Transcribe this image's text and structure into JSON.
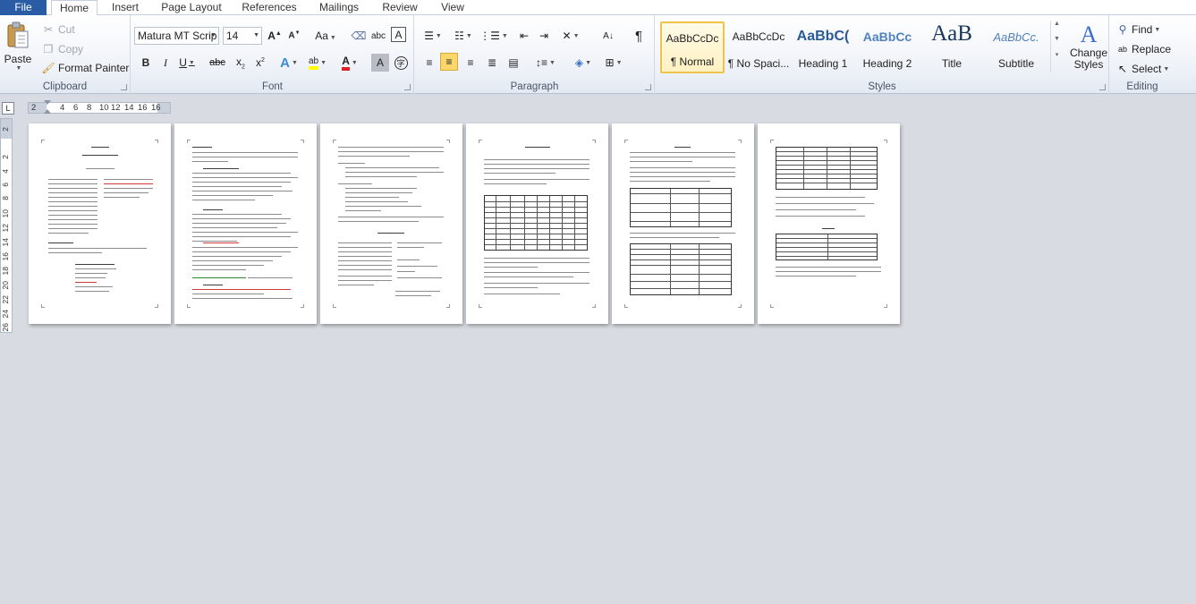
{
  "tabs": {
    "file": "File",
    "home": "Home",
    "insert": "Insert",
    "page_layout": "Page Layout",
    "references": "References",
    "mailings": "Mailings",
    "review": "Review",
    "view": "View"
  },
  "clipboard": {
    "label": "Clipboard",
    "paste": "Paste",
    "cut": "Cut",
    "copy": "Copy",
    "format_painter": "Format Painter"
  },
  "font": {
    "label": "Font",
    "name": "Matura MT Scrip",
    "size": "14"
  },
  "paragraph": {
    "label": "Paragraph"
  },
  "styles": {
    "label": "Styles",
    "items": [
      {
        "preview": "AaBbCcDc",
        "name": "¶ Normal"
      },
      {
        "preview": "AaBbCcDc",
        "name": "¶ No Spaci..."
      },
      {
        "preview": "AaBbC(",
        "name": "Heading 1"
      },
      {
        "preview": "AaBbCc",
        "name": "Heading 2"
      },
      {
        "preview": "AaB",
        "name": "Title"
      },
      {
        "preview": "AaBbCc.",
        "name": "Subtitle"
      }
    ],
    "change_styles": "Change Styles"
  },
  "editing": {
    "label": "Editing",
    "find": "Find",
    "replace": "Replace",
    "select": "Select"
  },
  "ruler": {
    "corner": "L",
    "h_ticks": [
      "2",
      "2",
      "4",
      "6",
      "8",
      "10",
      "12",
      "14",
      "16"
    ],
    "v_ticks": [
      "2",
      "2",
      "4",
      "6",
      "8",
      "10",
      "12",
      "14",
      "16",
      "18",
      "20",
      "22",
      "24",
      "26"
    ]
  },
  "colors": {
    "file_tab": "#2a5ca6",
    "selected_style": "#fbd66a",
    "canvas": "#d8dce2"
  }
}
